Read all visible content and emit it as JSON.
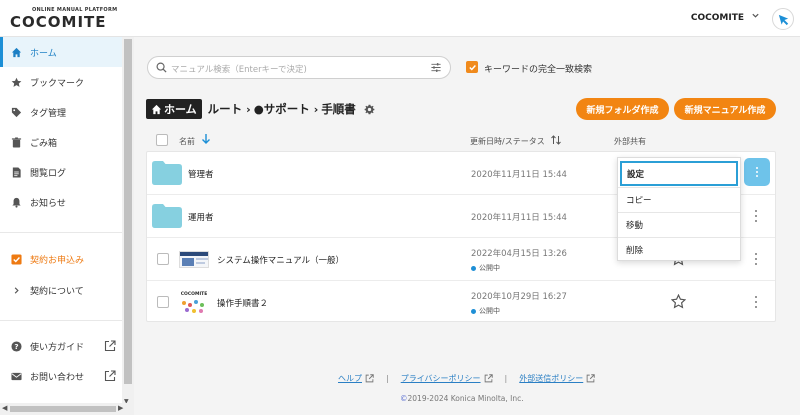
{
  "header": {
    "logo_sub": "ONLINE MANUAL PLATFORM",
    "logo_main": "COCOMITE",
    "user_name": "COCOMITE",
    "accent": "#1c8fd6"
  },
  "sidebar": {
    "items": [
      {
        "label": "ホーム",
        "icon": "home-icon"
      },
      {
        "label": "ブックマーク",
        "icon": "star-icon"
      },
      {
        "label": "タグ管理",
        "icon": "tag-icon"
      },
      {
        "label": "ごみ箱",
        "icon": "trash-icon"
      },
      {
        "label": "閲覧ログ",
        "icon": "document-icon"
      },
      {
        "label": "お知らせ",
        "icon": "bell-icon"
      }
    ],
    "contract_apply": "契約お申込み",
    "contract_about": "契約について",
    "guide": "使い方ガイド",
    "contact": "お問い合わせ"
  },
  "search": {
    "placeholder": "マニュアル検索（Enterキーで決定)",
    "keyword_exact": "キーワードの完全一致検索"
  },
  "breadcrumb": {
    "home": "ホーム",
    "items": [
      "ルート",
      "●サポート",
      "手順書"
    ]
  },
  "buttons": {
    "new_folder": "新規フォルダ作成",
    "new_manual": "新規マニュアル作成"
  },
  "table": {
    "col_name": "名前",
    "col_date": "更新日時/ステータス",
    "col_share": "外部共有",
    "rows": [
      {
        "name": "管理者",
        "date": "2020年11月11日 15:44",
        "status": ""
      },
      {
        "name": "運用者",
        "date": "2020年11月11日 15:44",
        "status": ""
      },
      {
        "name": "システム操作マニュアル（一般）",
        "date": "2022年04月15日 13:26",
        "status": "公開中"
      },
      {
        "name": "操作手順書２",
        "date": "2020年10月29日 16:27",
        "status": "公開中"
      }
    ]
  },
  "context_menu": {
    "items": [
      "設定",
      "コピー",
      "移動",
      "削除"
    ]
  },
  "footer": {
    "help": "ヘルプ",
    "privacy": "プライバシーポリシー",
    "external": "外部送信ポリシー",
    "copyright": "2019-2024 Konica Minolta, Inc."
  }
}
